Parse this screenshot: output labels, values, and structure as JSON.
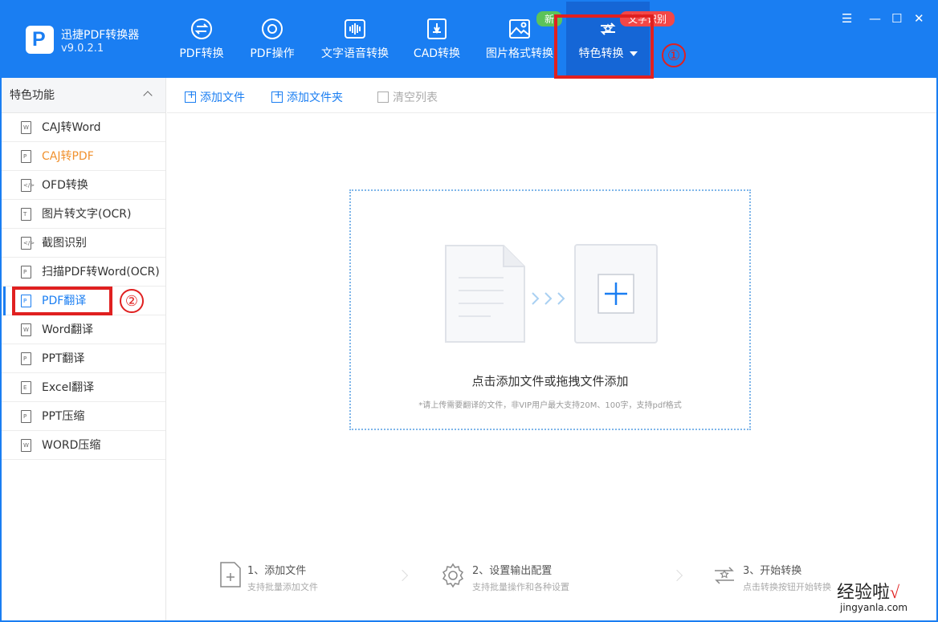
{
  "app": {
    "name": "迅捷PDF转换器",
    "version": "v9.0.2.1",
    "logo_letter": "P"
  },
  "nav": [
    {
      "label": "PDF转换",
      "icon": "pdf-convert-icon"
    },
    {
      "label": "PDF操作",
      "icon": "pdf-operate-icon"
    },
    {
      "label": "文字语音转换",
      "icon": "text-speech-icon"
    },
    {
      "label": "CAD转换",
      "icon": "cad-icon"
    },
    {
      "label": "图片格式转换",
      "icon": "image-format-icon"
    },
    {
      "label": "特色转换",
      "icon": "special-convert-icon"
    }
  ],
  "badges": {
    "new": "新",
    "hot": "文字识别"
  },
  "annotations": {
    "one": "①",
    "two": "②"
  },
  "sidebar": {
    "header": "特色功能",
    "items": [
      {
        "label": "CAJ转Word",
        "glyph": "W"
      },
      {
        "label": "CAJ转PDF",
        "glyph": "P"
      },
      {
        "label": "OFD转换",
        "glyph": "</>"
      },
      {
        "label": "图片转文字(OCR)",
        "glyph": "T"
      },
      {
        "label": "截图识别",
        "glyph": "</>"
      },
      {
        "label": "扫描PDF转Word(OCR)",
        "glyph": "P"
      },
      {
        "label": "PDF翻译",
        "glyph": "P"
      },
      {
        "label": "Word翻译",
        "glyph": "W"
      },
      {
        "label": "PPT翻译",
        "glyph": "P"
      },
      {
        "label": "Excel翻译",
        "glyph": "E"
      },
      {
        "label": "PPT压缩",
        "glyph": "P"
      },
      {
        "label": "WORD压缩",
        "glyph": "W"
      }
    ]
  },
  "toolbar": {
    "add_file": "添加文件",
    "add_folder": "添加文件夹",
    "clear_list": "清空列表"
  },
  "dropzone": {
    "main": "点击添加文件或拖拽文件添加",
    "sub": "*请上传需要翻译的文件，非VIP用户最大支持20M、100字，支持pdf格式"
  },
  "steps": [
    {
      "title": "1、添加文件",
      "sub": "支持批量添加文件"
    },
    {
      "title": "2、设置输出配置",
      "sub": "支持批量操作和各种设置"
    },
    {
      "title": "3、开始转换",
      "sub": "点击转换按钮开始转换"
    }
  ],
  "watermark": {
    "main": "经验啦",
    "check": "√",
    "sub": "jingyanla.com"
  },
  "colors": {
    "primary": "#1a7ef2",
    "active_nav": "#1566d6",
    "highlight": "#e02020",
    "orange_item": "#f0912e"
  }
}
